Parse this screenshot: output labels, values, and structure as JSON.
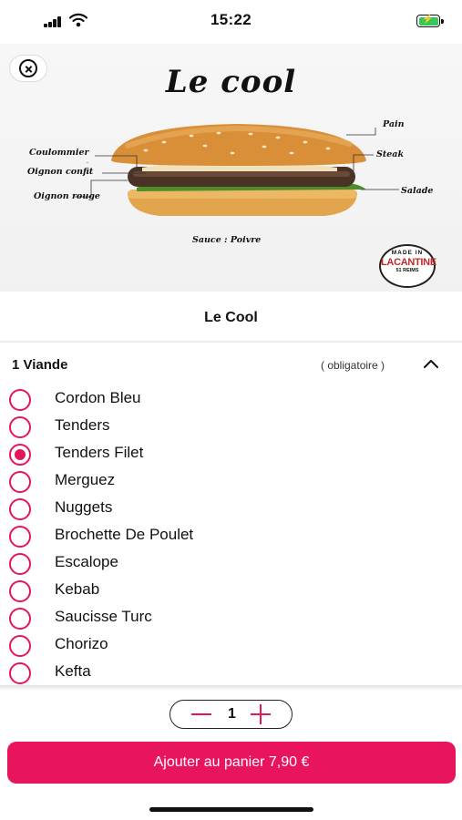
{
  "status_bar": {
    "time": "15:22",
    "battery_state": "charging"
  },
  "hero": {
    "title": "Le cool",
    "labels": {
      "coulommier": "Coulommier",
      "oignon_confit": "Oignon confit",
      "oignon_rouge": "Oignon rouge",
      "pain": "Pain",
      "steak": "Steak",
      "salade": "Salade",
      "sauce": "Sauce : Poivre"
    },
    "logo": {
      "top": "MADE IN",
      "brand": "LACANTINE",
      "sub1": "51",
      "sub2": "REIMS"
    }
  },
  "product": {
    "title": "Le Cool"
  },
  "option_group": {
    "title": "1 Viande",
    "requirement": "( obligatoire )",
    "expanded": true,
    "selected": "Tenders Filet",
    "items": [
      {
        "label": "Cordon Bleu",
        "checked": false
      },
      {
        "label": "Tenders",
        "checked": false
      },
      {
        "label": "Tenders Filet",
        "checked": true
      },
      {
        "label": "Merguez",
        "checked": false
      },
      {
        "label": "Nuggets",
        "checked": false
      },
      {
        "label": "Brochette De Poulet",
        "checked": false
      },
      {
        "label": "Escalope",
        "checked": false
      },
      {
        "label": "Kebab",
        "checked": false
      },
      {
        "label": "Saucisse Turc",
        "checked": false
      },
      {
        "label": "Chorizo",
        "checked": false
      },
      {
        "label": "Kefta",
        "checked": false
      }
    ]
  },
  "quantity": {
    "value": "1"
  },
  "cart_button": {
    "label": "Ajouter au panier 7,90 €"
  },
  "colors": {
    "accent": "#e8145e",
    "radio": "#e3165b",
    "battery": "#34c759"
  }
}
